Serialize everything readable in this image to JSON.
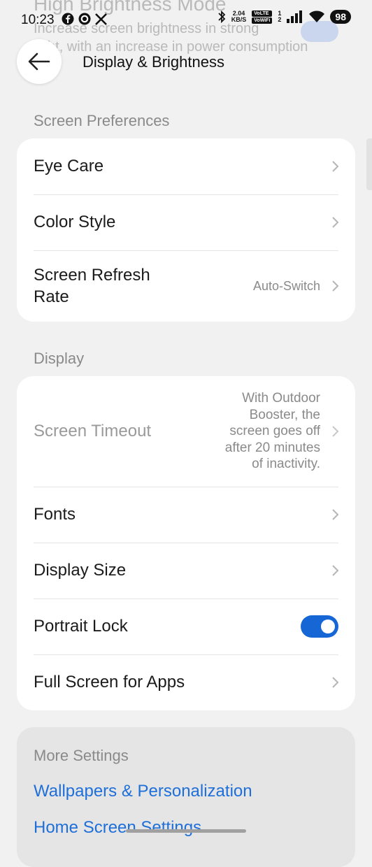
{
  "status_bar": {
    "time": "10:23",
    "net_speed_top": "2.04",
    "net_speed_bottom": "KB/S",
    "volte_top": "VoLTE",
    "volte_bottom": "VoWiFi",
    "sim1": "1",
    "sim2": "2",
    "battery": "98"
  },
  "ghost": {
    "title": "High Brightness Mode",
    "line1": "Increase screen brightness in strong",
    "line2": "light, with an increase in power consumption"
  },
  "header": {
    "title": "Display & Brightness"
  },
  "screen_preferences": {
    "label": "Screen Preferences",
    "items": [
      {
        "label": "Eye Care"
      },
      {
        "label": "Color Style"
      },
      {
        "label": "Screen Refresh\nRate",
        "value": "Auto-Switch"
      }
    ]
  },
  "display": {
    "label": "Display",
    "items": [
      {
        "label": "Screen Timeout",
        "value": "With Outdoor\nBooster, the\nscreen goes off\nafter 20 minutes\nof inactivity."
      },
      {
        "label": "Fonts"
      },
      {
        "label": "Display Size"
      },
      {
        "label": "Portrait Lock",
        "toggle": true
      },
      {
        "label": "Full Screen for Apps"
      }
    ]
  },
  "more_settings": {
    "label": "More Settings",
    "links": [
      "Wallpapers & Personalization",
      "Home Screen Settings"
    ]
  },
  "colors": {
    "accent": "#1766d6",
    "link": "#1e6fd9"
  }
}
